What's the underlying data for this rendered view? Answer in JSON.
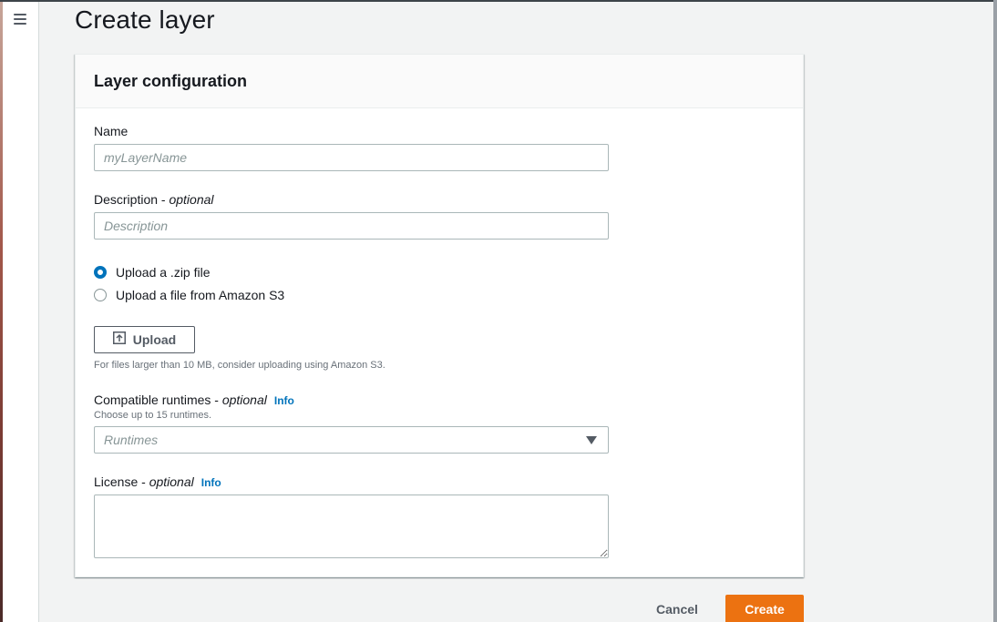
{
  "page": {
    "title": "Create layer"
  },
  "nav": {
    "menu_icon": "hamburger-menu-icon"
  },
  "panel": {
    "title": "Layer configuration"
  },
  "name_field": {
    "label": "Name",
    "placeholder": "myLayerName",
    "value": ""
  },
  "description_field": {
    "label": "Description - ",
    "optional": "optional",
    "placeholder": "Description",
    "value": ""
  },
  "upload_source": {
    "options": [
      {
        "label": "Upload a .zip file",
        "selected": true
      },
      {
        "label": "Upload a file from Amazon S3",
        "selected": false
      }
    ]
  },
  "upload": {
    "button_label": "Upload",
    "icon": "upload-icon",
    "hint": "For files larger than 10 MB, consider uploading using Amazon S3."
  },
  "runtimes_field": {
    "label": "Compatible runtimes - ",
    "optional": "optional",
    "info": "Info",
    "hint": "Choose up to 15 runtimes.",
    "placeholder": "Runtimes"
  },
  "license_field": {
    "label": "License - ",
    "optional": "optional",
    "info": "Info",
    "value": ""
  },
  "actions": {
    "cancel": "Cancel",
    "create": "Create"
  },
  "colors": {
    "primary_button": "#ec7211",
    "link": "#0073bb",
    "radio_selected": "#0073bb"
  }
}
